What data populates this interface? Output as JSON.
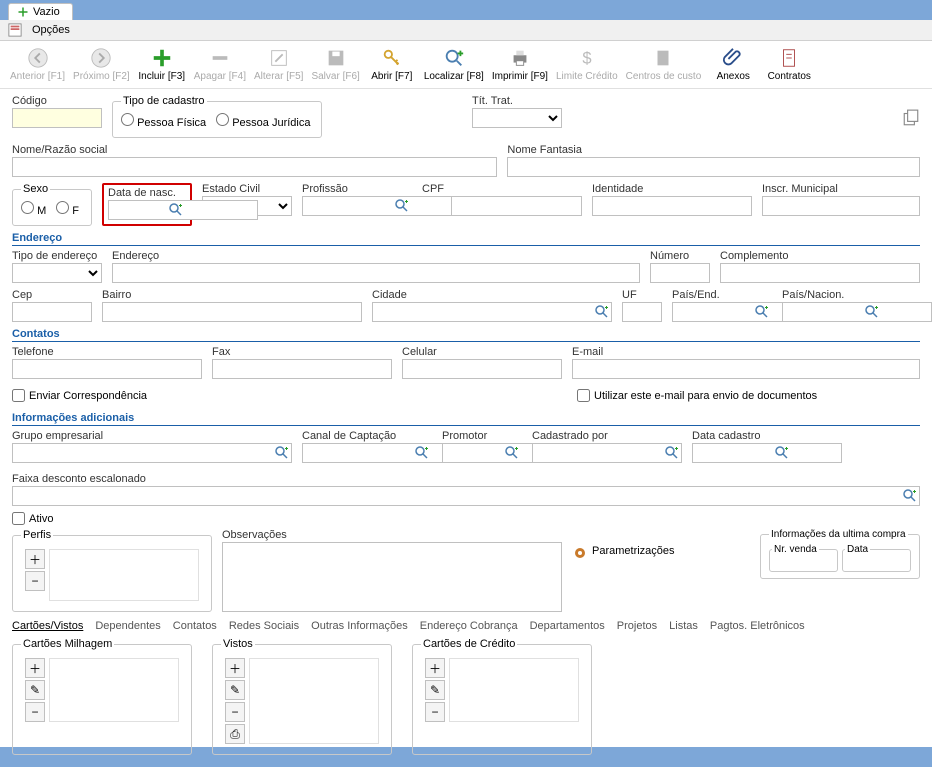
{
  "tab": {
    "title": "Vazio"
  },
  "menu": {
    "opcoes": "Opções"
  },
  "toolbar": {
    "anterior": "Anterior [F1]",
    "proximo": "Próximo [F2]",
    "incluir": "Incluir [F3]",
    "apagar": "Apagar [F4]",
    "alterar": "Alterar [F5]",
    "salvar": "Salvar [F6]",
    "abrir": "Abrir [F7]",
    "localizar": "Localizar [F8]",
    "imprimir": "Imprimir [F9]",
    "limite": "Limite Crédito",
    "centros": "Centros de custo",
    "anexos": "Anexos",
    "contratos": "Contratos"
  },
  "basic": {
    "codigo_label": "Código",
    "tipo_cadastro_label": "Tipo de cadastro",
    "pessoa_fisica": "Pessoa Física",
    "pessoa_juridica": "Pessoa Jurídica",
    "tit_trat_label": "Tít. Trat.",
    "nome_label": "Nome/Razão social",
    "fantasia_label": "Nome Fantasia",
    "sexo_label": "Sexo",
    "sexo_m": "M",
    "sexo_f": "F",
    "data_nasc_label": "Data de nasc.",
    "estado_civil_label": "Estado Civil",
    "profissao_label": "Profissão",
    "cpf_label": "CPF",
    "identidade_label": "Identidade",
    "inscr_label": "Inscr. Municipal"
  },
  "endereco": {
    "title": "Endereço",
    "tipo_label": "Tipo de endereço",
    "endereco_label": "Endereço",
    "numero_label": "Número",
    "complemento_label": "Complemento",
    "cep_label": "Cep",
    "bairro_label": "Bairro",
    "cidade_label": "Cidade",
    "uf_label": "UF",
    "pais_end_label": "País/End.",
    "pais_nac_label": "País/Nacion."
  },
  "contatos": {
    "title": "Contatos",
    "telefone_label": "Telefone",
    "fax_label": "Fax",
    "celular_label": "Celular",
    "email_label": "E-mail",
    "enviar_corr_label": "Enviar Correspondência",
    "usar_email_label": "Utilizar este e-mail para envio de documentos"
  },
  "adicionais": {
    "title": "Informações adicionais",
    "grupo_label": "Grupo empresarial",
    "canal_label": "Canal de Captação",
    "promotor_label": "Promotor",
    "cadastrado_label": "Cadastrado por",
    "data_cad_label": "Data cadastro",
    "faixa_label": "Faixa desconto escalonado",
    "ativo_label": "Ativo",
    "perfis_label": "Perfis",
    "observacoes_label": "Observações",
    "param_label": "Parametrizações",
    "ultima_compra_label": "Informações da ultima compra",
    "nr_venda_label": "Nr. venda",
    "data_label": "Data"
  },
  "subtabs": {
    "cartoes": "Cartões/Vistos",
    "dependentes": "Dependentes",
    "contatos": "Contatos",
    "redes": "Redes Sociais",
    "outras": "Outras Informações",
    "end_cobranca": "Endereço Cobrança",
    "departamentos": "Departamentos",
    "projetos": "Projetos",
    "listas": "Listas",
    "pagtos": "Pagtos. Eletrônicos"
  },
  "cards": {
    "milhagem_label": "Cartões Milhagem",
    "vistos_label": "Vistos",
    "credito_label": "Cartões de Crédito"
  }
}
